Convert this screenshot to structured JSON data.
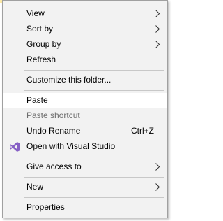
{
  "menu": {
    "items": [
      {
        "label": "View",
        "submenu": true
      },
      {
        "label": "Sort by",
        "submenu": true
      },
      {
        "label": "Group by",
        "submenu": true
      },
      {
        "label": "Refresh"
      },
      {
        "label": "Customize this folder..."
      },
      {
        "label": "Paste",
        "highlighted": true
      },
      {
        "label": "Paste shortcut",
        "disabled": true
      },
      {
        "label": "Undo Rename",
        "shortcut": "Ctrl+Z"
      },
      {
        "label": "Open with Visual Studio",
        "icon": "visual-studio-icon"
      },
      {
        "label": "Give access to",
        "submenu": true
      },
      {
        "label": "New",
        "submenu": true
      },
      {
        "label": "Properties"
      }
    ]
  },
  "colors": {
    "menu_bg": "#f2f2f2",
    "highlight_bg": "#ffffff",
    "disabled_text": "#6d6d6d",
    "separator": "#c8c8c8",
    "visual_studio_purple": "#865fc5"
  }
}
